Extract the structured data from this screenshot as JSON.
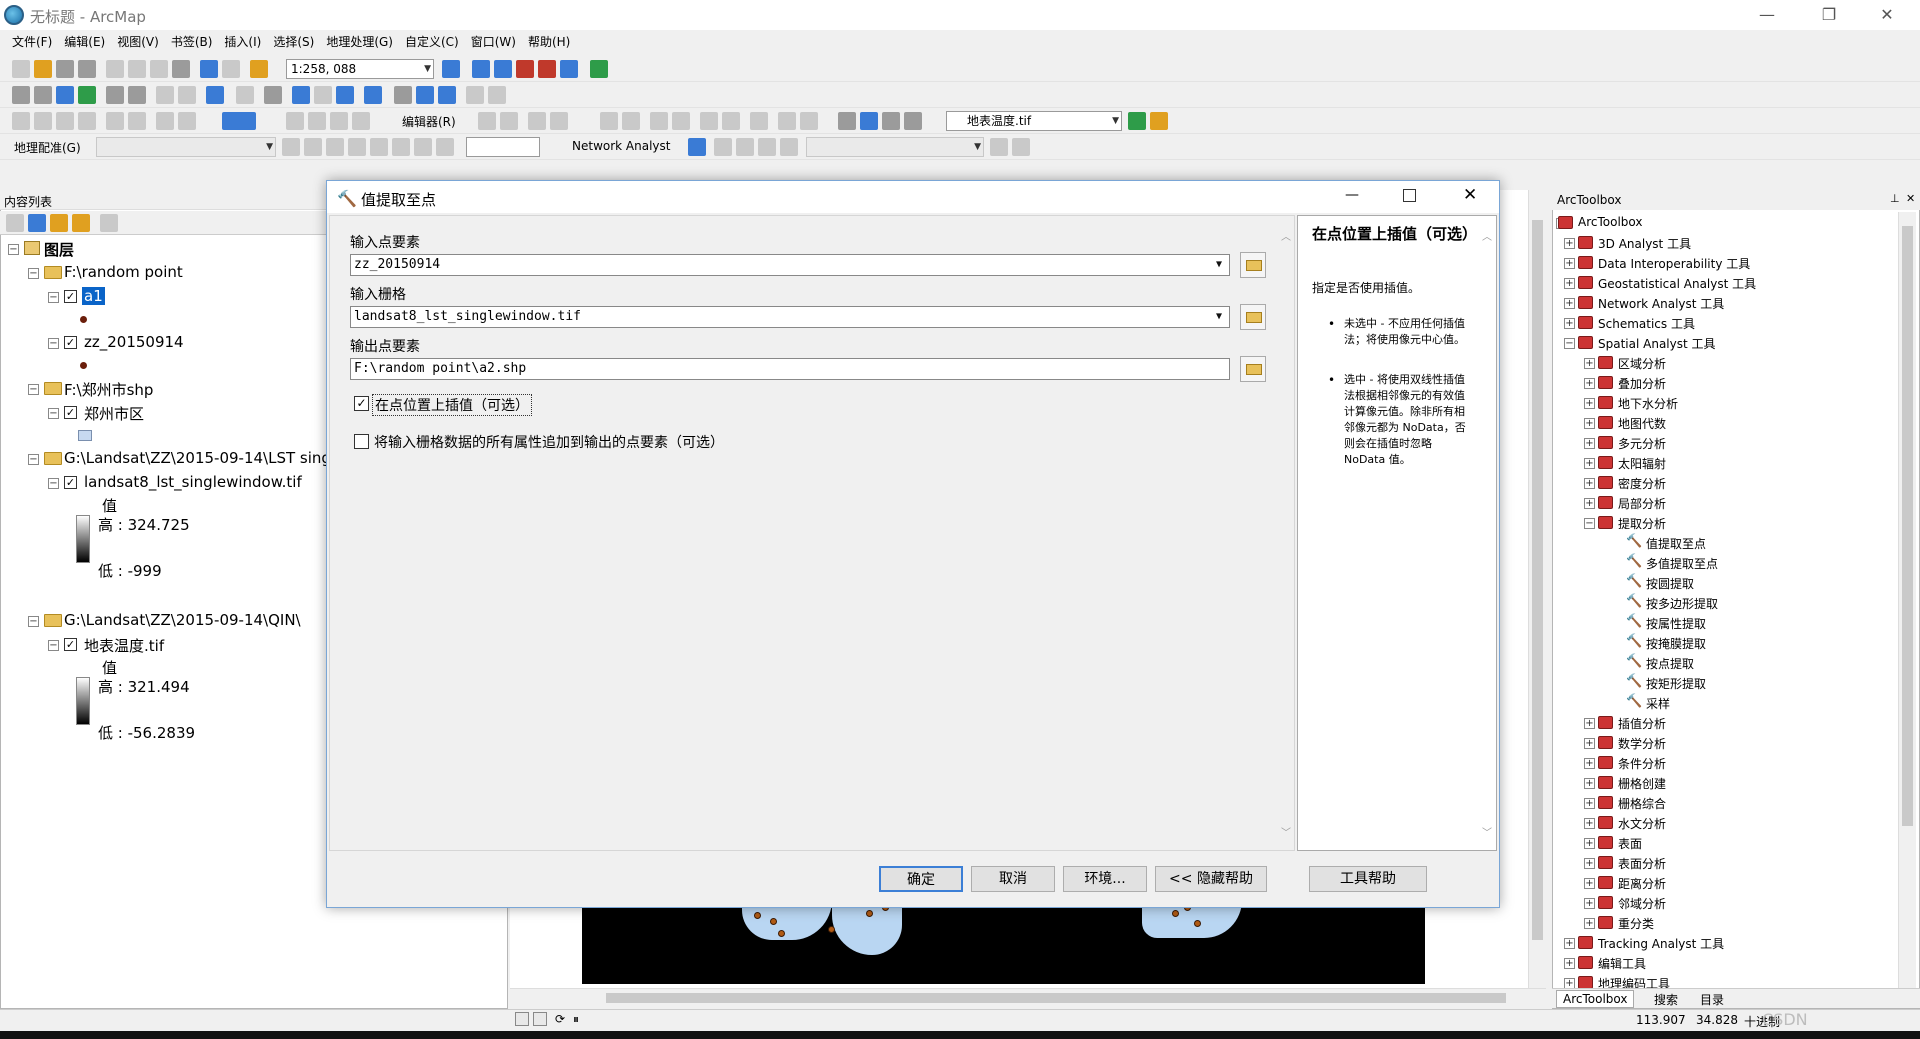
{
  "window": {
    "title": "无标题 - ArcMap",
    "minimize": "—",
    "restore": "❐",
    "close": "✕"
  },
  "menubar": [
    "文件(F)",
    "编辑(E)",
    "视图(V)",
    "书签(B)",
    "插入(I)",
    "选择(S)",
    "地理处理(G)",
    "自定义(C)",
    "窗口(W)",
    "帮助(H)"
  ],
  "toolbar": {
    "scale": "1:258, 088",
    "editor_label": "编辑器(R)",
    "layer_select": "地表温度.tif",
    "georef_label": "地理配准(G)",
    "network_analyst_label": "Network Analyst"
  },
  "toc": {
    "header": "内容列表",
    "root": "图层",
    "groups": [
      {
        "path": "F:\\random point",
        "layers": [
          {
            "name": "a1",
            "selected": true
          },
          {
            "name": "zz_20150914",
            "selected": false
          }
        ]
      },
      {
        "path": "F:\\郑州市shp",
        "layers": [
          {
            "name": "郑州市区"
          }
        ]
      },
      {
        "path": "G:\\Landsat\\ZZ\\2015-09-14\\LST singl",
        "layers": [
          {
            "name": "landsat8_lst_singlewindow.tif",
            "value_label": "值",
            "high": "高 : 324.725",
            "low": "低 : -999"
          }
        ]
      },
      {
        "path": "G:\\Landsat\\ZZ\\2015-09-14\\QIN\\",
        "layers": [
          {
            "name": "地表温度.tif",
            "value_label": "值",
            "high": "高 : 321.494",
            "low": "低 : -56.2839"
          }
        ]
      }
    ]
  },
  "dialog": {
    "title": "值提取至点",
    "input_points_label": "输入点要素",
    "input_points_value": "zz_20150914",
    "input_raster_label": "输入栅格",
    "input_raster_value": "landsat8_lst_singlewindow.tif",
    "output_points_label": "输出点要素",
    "output_points_value": "F:\\random point\\a2.shp",
    "interpolate_label": "在点位置上插值（可选）",
    "interpolate_checked": true,
    "append_label": "将输入栅格数据的所有属性追加到输出的点要素（可选）",
    "append_checked": false,
    "buttons": {
      "ok": "确定",
      "cancel": "取消",
      "env": "环境...",
      "hide_help": "<< 隐藏帮助",
      "tool_help": "工具帮助"
    },
    "help": {
      "title": "在点位置上插值（可选）",
      "subtitle": "指定是否使用插值。",
      "bullets": [
        "未选中 - 不应用任何插值法；将使用像元中心值。",
        "选中 - 将使用双线性插值法根据相邻像元的有效值计算像元值。除非所有相邻像元都为 NoData，否则会在插值时忽略 NoData 值。"
      ]
    }
  },
  "arctoolbox": {
    "header": "ArcToolbox",
    "root": "ArcToolbox",
    "toolsets": [
      "3D Analyst 工具",
      "Data Interoperability 工具",
      "Geostatistical Analyst 工具",
      "Network Analyst 工具",
      "Schematics 工具",
      "Spatial Analyst 工具"
    ],
    "spatial_children": [
      "区域分析",
      "叠加分析",
      "地下水分析",
      "地图代数",
      "多元分析",
      "太阳辐射",
      "密度分析",
      "局部分析",
      "提取分析"
    ],
    "extract_tools": [
      "值提取至点",
      "多值提取至点",
      "按圆提取",
      "按多边形提取",
      "按属性提取",
      "按掩膜提取",
      "按点提取",
      "按矩形提取",
      "采样"
    ],
    "spatial_children_after": [
      "插值分析",
      "数学分析",
      "条件分析",
      "栅格创建",
      "栅格综合",
      "水文分析",
      "表面",
      "表面分析",
      "距离分析",
      "邻域分析",
      "重分类"
    ],
    "toolsets_after": [
      "Tracking Analyst 工具",
      "编辑工具",
      "地理编码工具"
    ],
    "tabs": [
      "ArcToolbox",
      "搜索",
      "目录"
    ]
  },
  "status": {
    "x": "113.907",
    "y": "34.828",
    "unit": "十进制",
    "watermark": "CSDN @Monster_Li~"
  }
}
